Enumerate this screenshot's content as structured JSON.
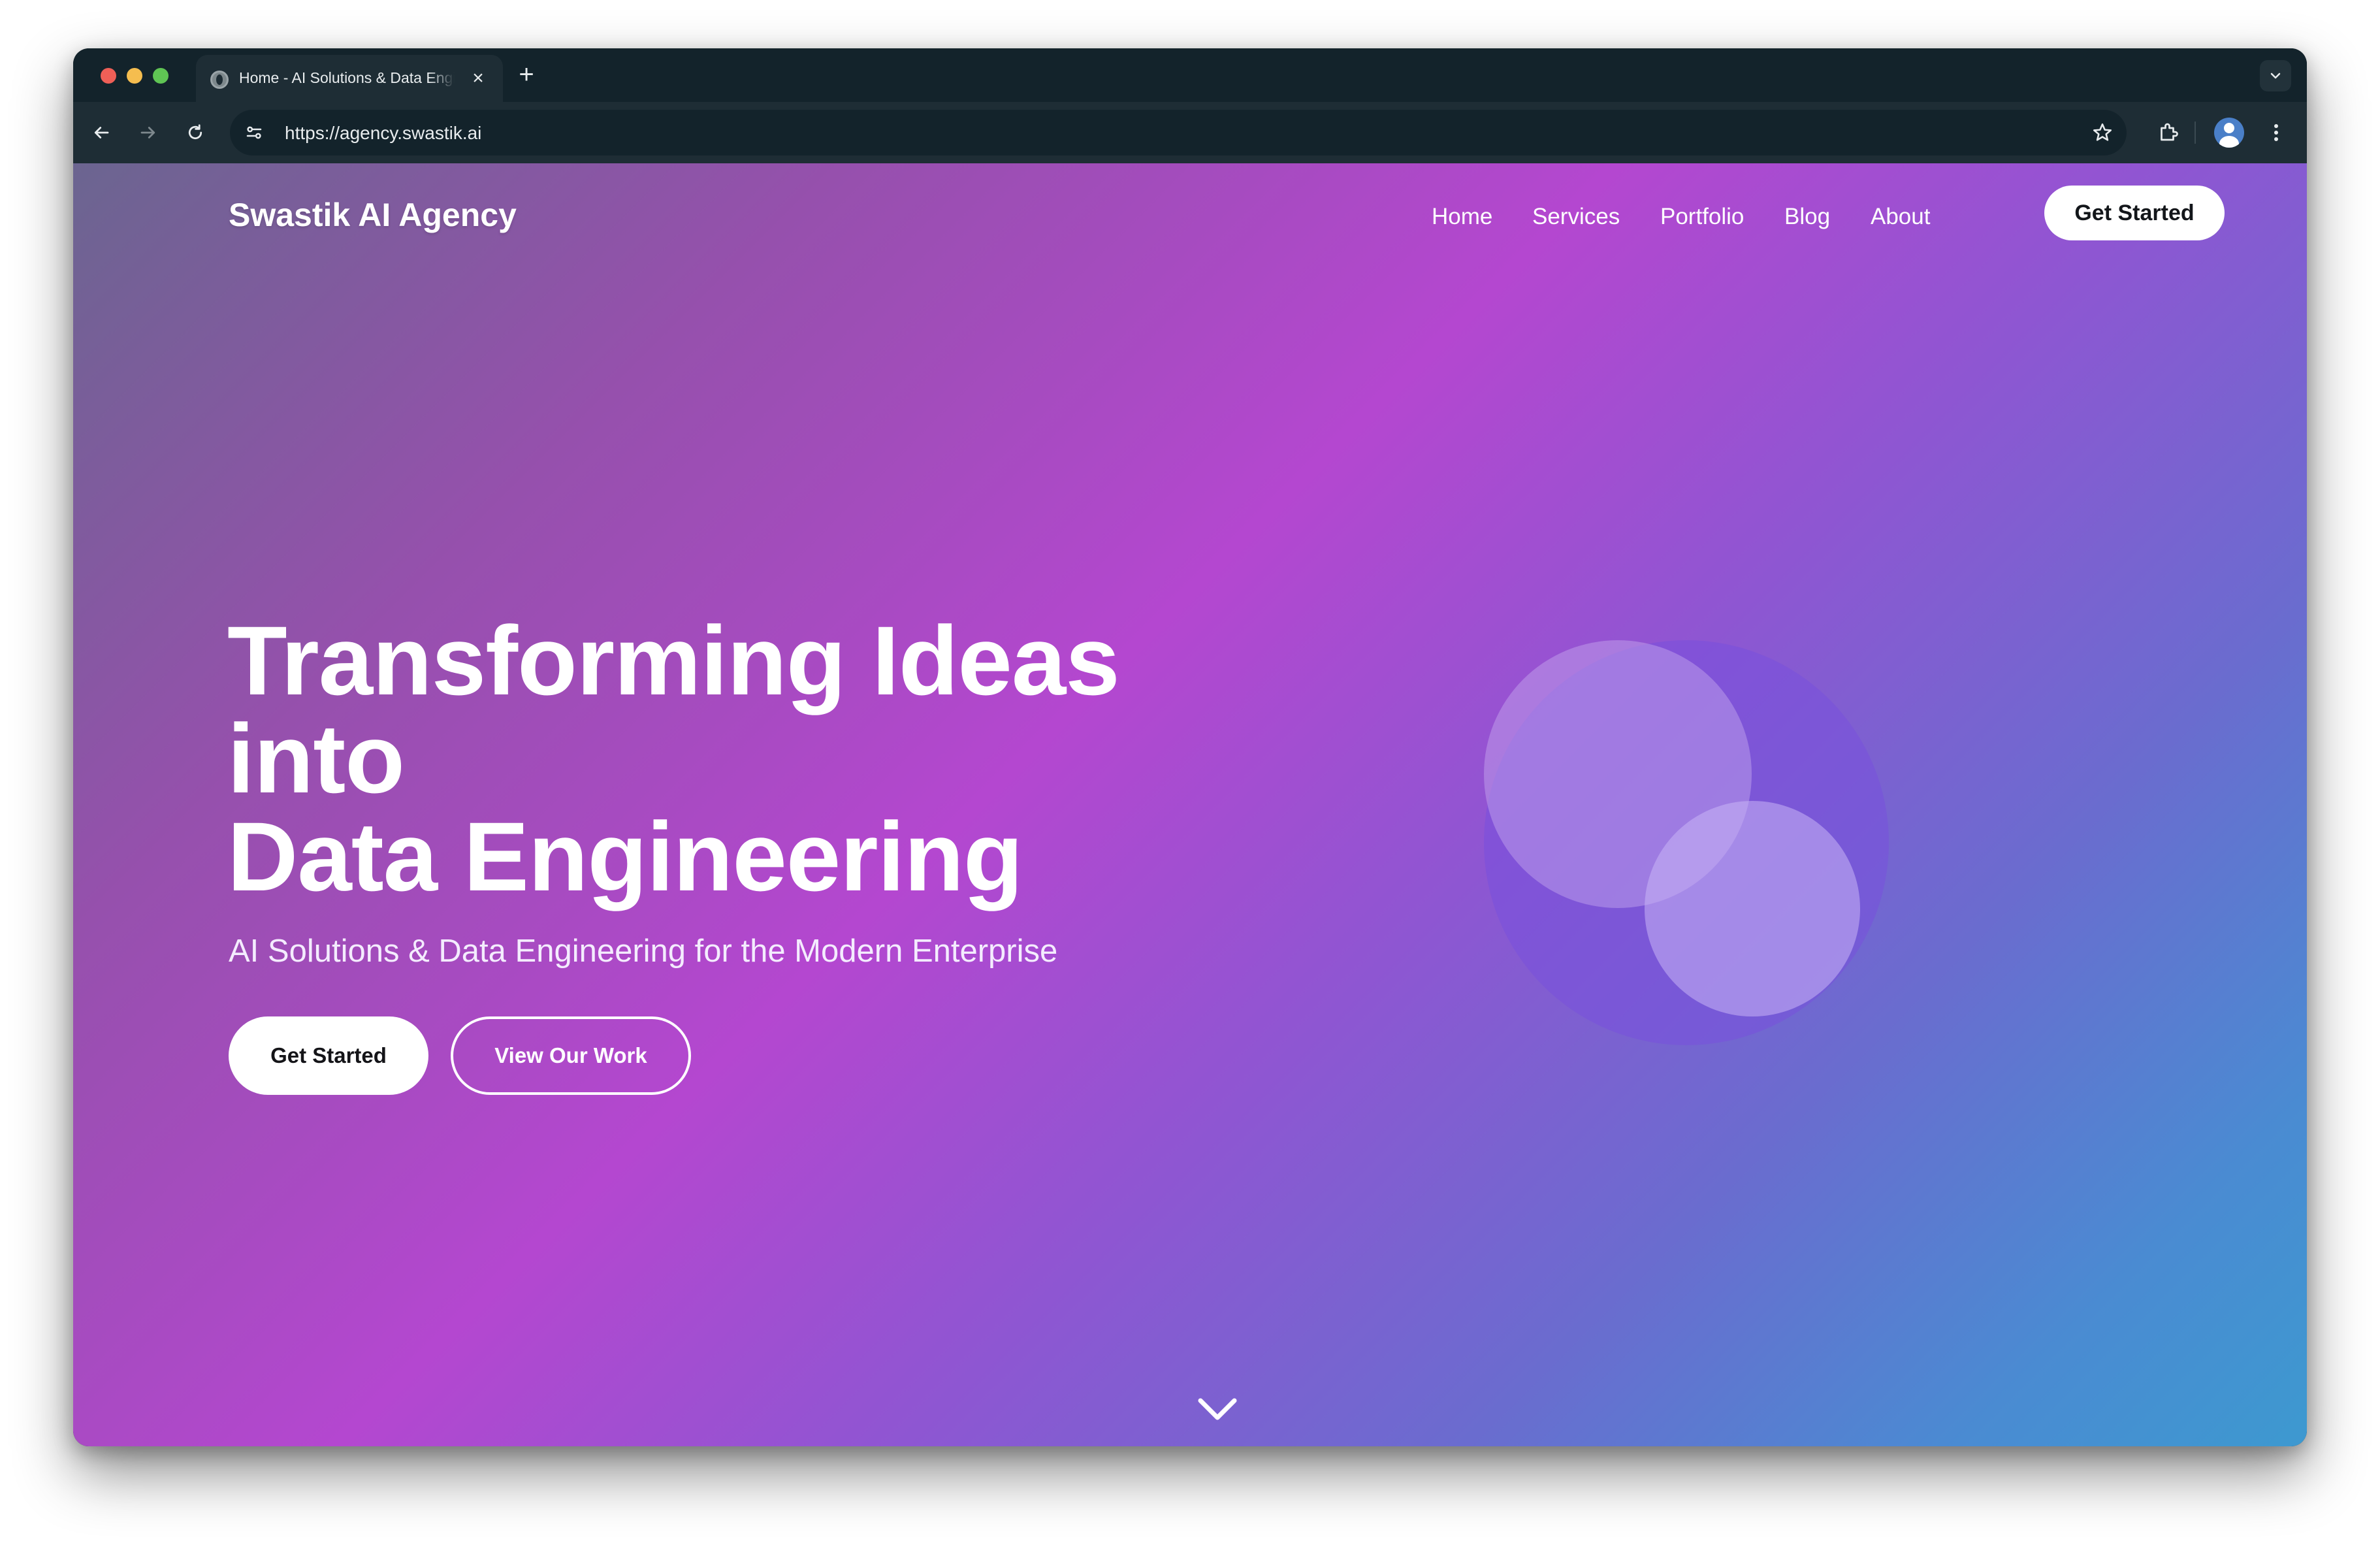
{
  "browser": {
    "tab_title": "Home - AI Solutions & Data Engineering",
    "new_tab_symbol": "+",
    "close_symbol": "×",
    "url": "https://agency.swastik.ai"
  },
  "site": {
    "brand": "Swastik AI Agency",
    "nav": {
      "home": "Home",
      "services": "Services",
      "portfolio": "Portfolio",
      "blog": "Blog",
      "about": "About",
      "cta": "Get Started"
    }
  },
  "hero": {
    "title_line1": "Transforming Ideas",
    "title_line2": "into",
    "title_line3": "Data Engineering",
    "subtitle": "AI Solutions & Data Engineering for the Modern Enterprise",
    "primary_button": "Get Started",
    "secondary_button": "View Our Work"
  },
  "colors": {
    "gradient_start": "#6b6590",
    "gradient_mid": "#b447d0",
    "gradient_end": "#3d99d0",
    "chrome_dark": "#13232b",
    "chrome_toolbar": "#1e2d35"
  },
  "icons": [
    "globe-icon",
    "close-icon",
    "plus-icon",
    "chevron-down-icon",
    "back-arrow-icon",
    "forward-arrow-icon",
    "reload-icon",
    "site-settings-icon",
    "star-icon",
    "extensions-icon",
    "profile-avatar-icon",
    "more-vert-icon",
    "scroll-down-chevron-icon"
  ]
}
